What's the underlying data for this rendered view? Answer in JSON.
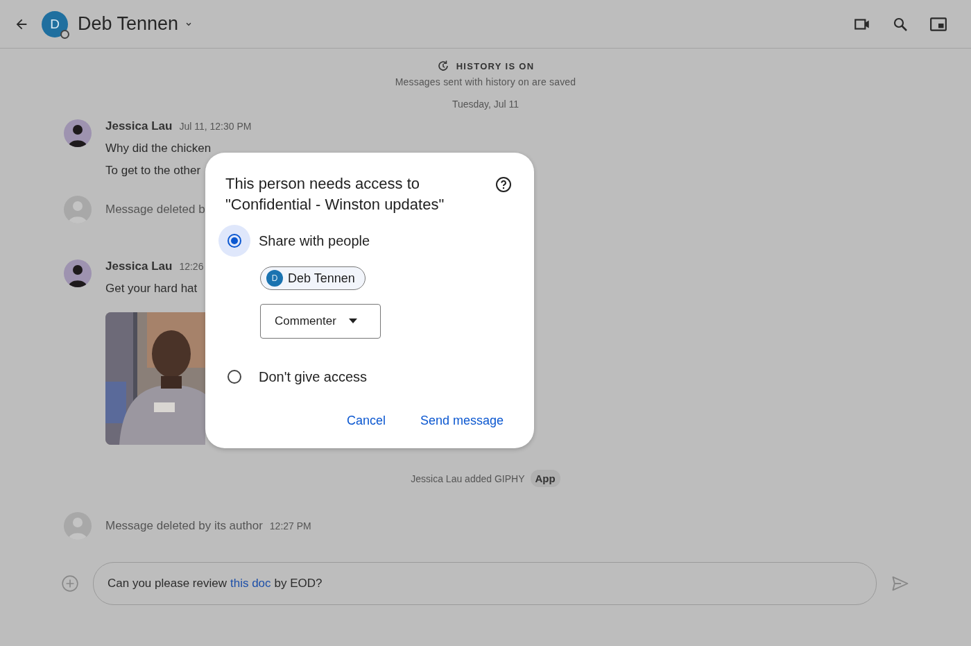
{
  "header": {
    "initial": "D",
    "name": "Deb Tennen"
  },
  "history": {
    "title": "HISTORY IS ON",
    "subtitle": "Messages sent with history on are saved",
    "date": "Tuesday, Jul 11"
  },
  "messages": [
    {
      "kind": "message",
      "author": "Jessica Lau",
      "time": "Jul 11, 12:30 PM",
      "lines": [
        "Why did the chicken",
        "To get to the other"
      ]
    },
    {
      "kind": "deleted",
      "text": "Message deleted b"
    },
    {
      "kind": "message",
      "author": "Jessica Lau",
      "time": "12:26",
      "lines": [
        "Get your hard hat"
      ],
      "picture": {
        "kind": "picture"
      }
    },
    {
      "kind": "system",
      "text": "Jessica Lau added GIPHY",
      "badge": "App"
    },
    {
      "kind": "deleted",
      "text": "Message deleted by its author",
      "time": "12:27 PM"
    }
  ],
  "composer": {
    "before": "Can you please review",
    "link": "this doc",
    "after": "by EOD?"
  },
  "dialog": {
    "title": "This person needs access to \"Confidential - Winston updates\"",
    "options": [
      {
        "label": "Share with people",
        "selected": true,
        "chip": {
          "initial": "D",
          "name": "Deb Tennen"
        },
        "dropdown": "Commenter"
      },
      {
        "label": "Don't give access",
        "selected": false
      }
    ],
    "buttons": [
      "Cancel",
      "Send message"
    ]
  }
}
